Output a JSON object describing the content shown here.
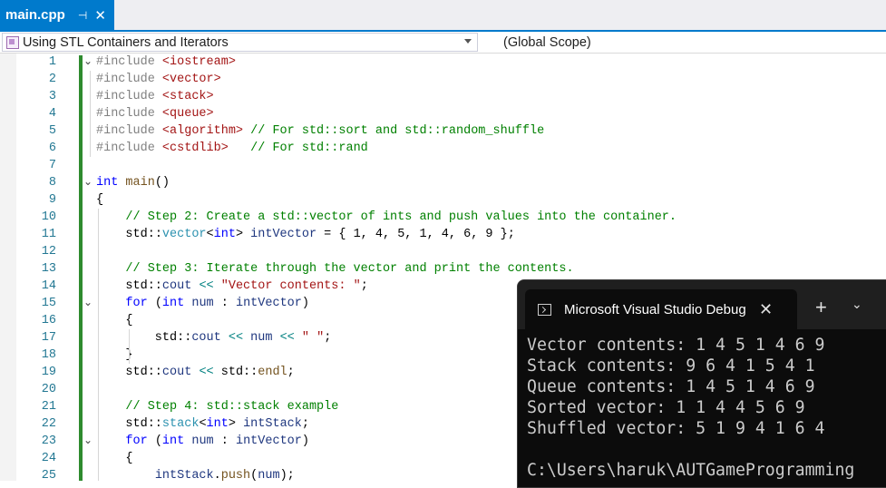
{
  "tab": {
    "title": "main.cpp",
    "pin_glyph": "⊣",
    "close_glyph": "✕"
  },
  "navbar": {
    "project": "Using STL Containers and Iterators",
    "scope": "(Global Scope)"
  },
  "colors": {
    "accent": "#007acc",
    "change_bar": "#2e8b2e",
    "comment": "#008000",
    "string": "#a31515",
    "keyword": "#0000ff",
    "type": "#2b91af"
  },
  "code_lines": [
    {
      "n": "1",
      "fold": "⌄",
      "tokens": [
        [
          "pp",
          "#include "
        ],
        [
          "str",
          "<iostream>"
        ]
      ]
    },
    {
      "n": "2",
      "fold": "",
      "tokens": [
        [
          "pp",
          "#include "
        ],
        [
          "str",
          "<vector>"
        ]
      ]
    },
    {
      "n": "3",
      "fold": "",
      "tokens": [
        [
          "pp",
          "#include "
        ],
        [
          "str",
          "<stack>"
        ]
      ]
    },
    {
      "n": "4",
      "fold": "",
      "tokens": [
        [
          "pp",
          "#include "
        ],
        [
          "str",
          "<queue>"
        ]
      ]
    },
    {
      "n": "5",
      "fold": "",
      "tokens": [
        [
          "pp",
          "#include "
        ],
        [
          "str",
          "<algorithm>"
        ],
        [
          "cm",
          " // For std::sort and std::random_shuffle"
        ]
      ]
    },
    {
      "n": "6",
      "fold": "",
      "tokens": [
        [
          "pp",
          "#include "
        ],
        [
          "str",
          "<cstdlib>"
        ],
        [
          "cm",
          "   // For std::rand"
        ]
      ]
    },
    {
      "n": "7",
      "fold": "",
      "tokens": []
    },
    {
      "n": "8",
      "fold": "⌄",
      "tokens": [
        [
          "kw",
          "int"
        ],
        [
          "pl",
          " "
        ],
        [
          "fn",
          "main"
        ],
        [
          "pl",
          "()"
        ]
      ]
    },
    {
      "n": "9",
      "fold": "",
      "tokens": [
        [
          "pl",
          "{"
        ]
      ]
    },
    {
      "n": "10",
      "fold": "",
      "tokens": [
        [
          "cm",
          "    // Step 2: Create a std::vector of ints and push values into the container."
        ]
      ]
    },
    {
      "n": "11",
      "fold": "",
      "tokens": [
        [
          "pl",
          "    std"
        ],
        [
          "pl",
          "::"
        ],
        [
          "ty",
          "vector"
        ],
        [
          "pl",
          "<"
        ],
        [
          "kw",
          "int"
        ],
        [
          "pl",
          "> "
        ],
        [
          "var",
          "intVector"
        ],
        [
          "pl",
          " = { 1, 4, 5, 1, 4, 6, 9 };"
        ]
      ]
    },
    {
      "n": "12",
      "fold": "",
      "tokens": []
    },
    {
      "n": "13",
      "fold": "",
      "tokens": [
        [
          "cm",
          "    // Step 3: Iterate through the vector and print the contents."
        ]
      ]
    },
    {
      "n": "14",
      "fold": "",
      "tokens": [
        [
          "pl",
          "    std::"
        ],
        [
          "var",
          "cout"
        ],
        [
          "pl",
          " "
        ],
        [
          "op",
          "<<"
        ],
        [
          "pl",
          " "
        ],
        [
          "str",
          "\"Vector contents: \""
        ],
        [
          "pl",
          ";"
        ]
      ]
    },
    {
      "n": "15",
      "fold": "⌄",
      "tokens": [
        [
          "kw",
          "    for"
        ],
        [
          "pl",
          " ("
        ],
        [
          "kw",
          "int"
        ],
        [
          "pl",
          " "
        ],
        [
          "var",
          "num"
        ],
        [
          "pl",
          " : "
        ],
        [
          "var",
          "intVector"
        ],
        [
          "pl",
          ")"
        ]
      ]
    },
    {
      "n": "16",
      "fold": "",
      "tokens": [
        [
          "pl",
          "    {"
        ]
      ]
    },
    {
      "n": "17",
      "fold": "",
      "tokens": [
        [
          "pl",
          "        std::"
        ],
        [
          "var",
          "cout"
        ],
        [
          "pl",
          " "
        ],
        [
          "op",
          "<<"
        ],
        [
          "pl",
          " "
        ],
        [
          "var",
          "num"
        ],
        [
          "pl",
          " "
        ],
        [
          "op",
          "<<"
        ],
        [
          "pl",
          " "
        ],
        [
          "str",
          "\" \""
        ],
        [
          "pl",
          ";"
        ]
      ]
    },
    {
      "n": "18",
      "fold": "",
      "tokens": [
        [
          "pl",
          "    }"
        ]
      ]
    },
    {
      "n": "19",
      "fold": "",
      "tokens": [
        [
          "pl",
          "    std::"
        ],
        [
          "var",
          "cout"
        ],
        [
          "pl",
          " "
        ],
        [
          "op",
          "<<"
        ],
        [
          "pl",
          " std::"
        ],
        [
          "fn",
          "endl"
        ],
        [
          "pl",
          ";"
        ]
      ]
    },
    {
      "n": "20",
      "fold": "",
      "tokens": []
    },
    {
      "n": "21",
      "fold": "",
      "tokens": [
        [
          "cm",
          "    // Step 4: std::stack example"
        ]
      ]
    },
    {
      "n": "22",
      "fold": "",
      "tokens": [
        [
          "pl",
          "    std::"
        ],
        [
          "ty",
          "stack"
        ],
        [
          "pl",
          "<"
        ],
        [
          "kw",
          "int"
        ],
        [
          "pl",
          "> "
        ],
        [
          "var",
          "intStack"
        ],
        [
          "pl",
          ";"
        ]
      ]
    },
    {
      "n": "23",
      "fold": "⌄",
      "tokens": [
        [
          "kw",
          "    for"
        ],
        [
          "pl",
          " ("
        ],
        [
          "kw",
          "int"
        ],
        [
          "pl",
          " "
        ],
        [
          "var",
          "num"
        ],
        [
          "pl",
          " : "
        ],
        [
          "var",
          "intVector"
        ],
        [
          "pl",
          ")"
        ]
      ]
    },
    {
      "n": "24",
      "fold": "",
      "tokens": [
        [
          "pl",
          "    {"
        ]
      ]
    },
    {
      "n": "25",
      "fold": "",
      "tokens": [
        [
          "pl",
          "        "
        ],
        [
          "var",
          "intStack"
        ],
        [
          "pl",
          "."
        ],
        [
          "fn",
          "push"
        ],
        [
          "pl",
          "("
        ],
        [
          "var",
          "num"
        ],
        [
          "pl",
          ");"
        ]
      ]
    }
  ],
  "console": {
    "title": "Microsoft Visual Studio Debug Console",
    "close_glyph": "✕",
    "new_tab_glyph": "+",
    "dropdown_glyph": "⌄",
    "lines": [
      "Vector contents: 1 4 5 1 4 6 9",
      "Stack contents: 9 6 4 1 5 4 1",
      "Queue contents: 1 4 5 1 4 6 9",
      "Sorted vector: 1 1 4 4 5 6 9",
      "Shuffled vector: 5 1 9 4 1 6 4",
      "",
      "C:\\Users\\haruk\\AUTGameProgramming"
    ]
  }
}
